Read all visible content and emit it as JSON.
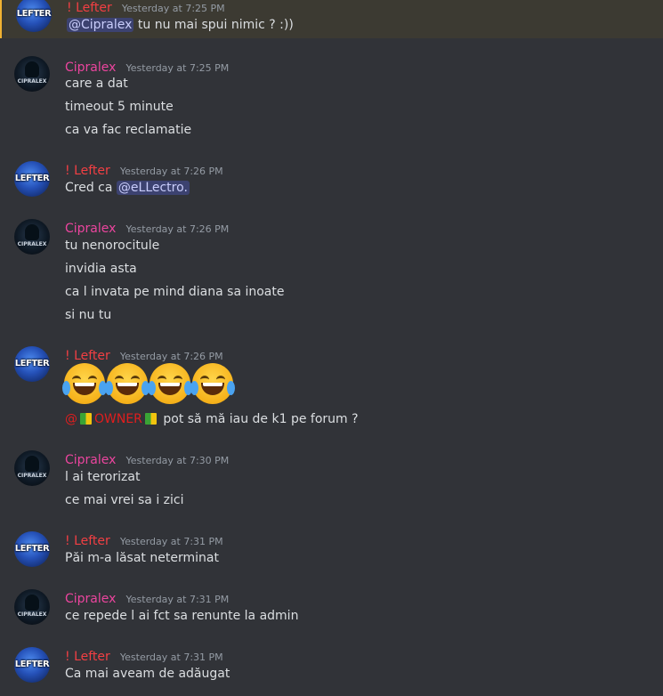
{
  "messages": [
    {
      "author": "! Lefter",
      "timestamp": "Yesterday at 7:25 PM",
      "mention": "@Cipralex",
      "text": "tu nu mai spui nimic ? :))"
    },
    {
      "author": "Cipralex",
      "timestamp": "Yesterday at 7:25 PM",
      "lines": [
        "care a dat",
        "timeout 5 minute",
        "ca va fac reclamatie"
      ]
    },
    {
      "author": "! Lefter",
      "timestamp": "Yesterday at 7:26 PM",
      "prefix": "Cred ca",
      "mention": "@eLLectro."
    },
    {
      "author": "Cipralex",
      "timestamp": "Yesterday at 7:26 PM",
      "lines": [
        "tu nenorocitule",
        "invidia asta",
        "ca l invata pe mind diana sa inoate",
        "si nu tu"
      ]
    },
    {
      "author": "! Lefter",
      "timestamp": "Yesterday at 7:26 PM",
      "emojis": [
        "joy",
        "joy",
        "joy",
        "joy"
      ],
      "role_mention_at": "@",
      "role_mention": "OWNER",
      "text": "pot să mă iau de k1 pe forum ?"
    },
    {
      "author": "Cipralex",
      "timestamp": "Yesterday at 7:30 PM",
      "lines": [
        "l ai terorizat",
        "ce mai vrei sa i zici"
      ]
    },
    {
      "author": "! Lefter",
      "timestamp": "Yesterday at 7:31 PM",
      "lines": [
        "Păi m-a lăsat neterminat"
      ]
    },
    {
      "author": "Cipralex",
      "timestamp": "Yesterday at 7:31 PM",
      "lines": [
        "ce repede l ai fct sa renunte la admin"
      ]
    },
    {
      "author": "! Lefter",
      "timestamp": "Yesterday at 7:31 PM",
      "lines": [
        "Ca mai aveam de adăugat"
      ]
    }
  ],
  "avatars": {
    "lefter_label": "LEFTER",
    "cipralex_label": "CIPRALEX"
  },
  "colors": {
    "background": "#313338",
    "lefter_name": "#f23f43",
    "cipralex_name": "#eb459e",
    "mention_bg": "#3c4270",
    "highlight_border": "#f0b232"
  }
}
